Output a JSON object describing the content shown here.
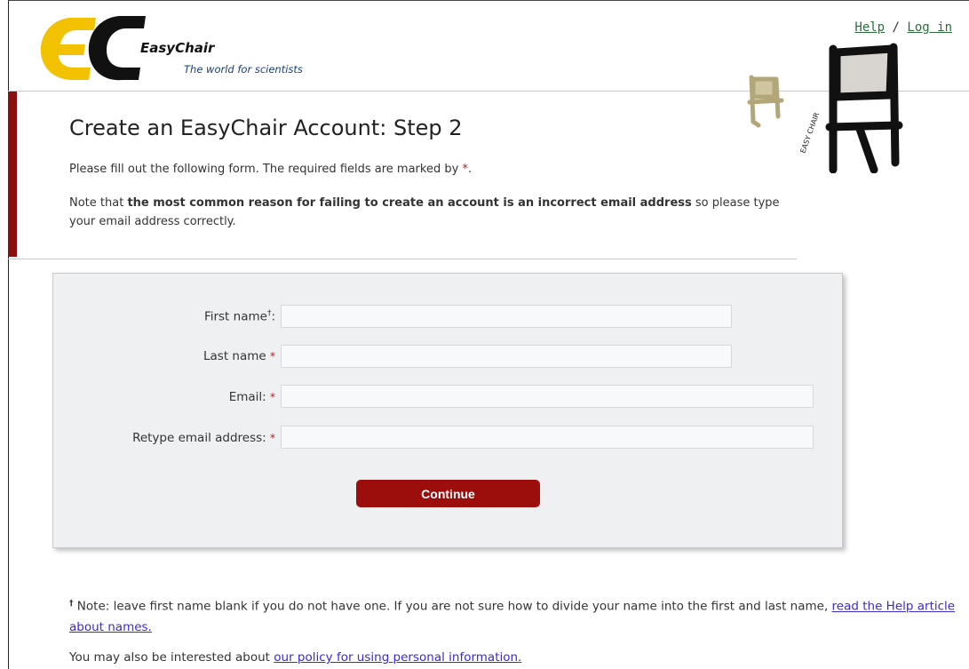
{
  "header": {
    "logo_name": "EasyChair",
    "logo_tagline": "The world for scientists",
    "help_link": "Help",
    "separator": "/",
    "login_link": "Log in"
  },
  "page": {
    "title": "Create an EasyChair Account: Step 2",
    "intro": "Please fill out the following form. The required fields are marked by",
    "required_mark": "*",
    "intro_end": ".",
    "note_prefix": "Note that ",
    "note_bold": "the most common reason for failing to create an account is an incorrect email address",
    "note_suffix": " so please type your email address correctly."
  },
  "chair_art_label": "EASY CHAIR",
  "form": {
    "first_name_label": "First name",
    "dagger": "†",
    "first_name_colon": ":",
    "last_name_label": "Last name",
    "email_label": "Email:",
    "retype_label": "Retype email address:",
    "required_mark": "*",
    "first_name_value": "",
    "last_name_value": "",
    "email_value": "",
    "retype_value": "",
    "continue_label": "Continue"
  },
  "footer": {
    "dagger": "†",
    "note_text": " Note: leave first name blank if you do not have one. If you are not sure how to divide your name into the first and last name, ",
    "names_link": "read the Help article about names.",
    "policy_prefix": "You may also be interested about ",
    "policy_link": "our policy for using personal information."
  },
  "colors": {
    "accent": "#8b1010",
    "button": "#9b0e0b",
    "required": "#c0151b",
    "panel_bg": "#eef0f2",
    "link_top": "#2a6e3a",
    "link_footer": "#3a2ad0"
  }
}
